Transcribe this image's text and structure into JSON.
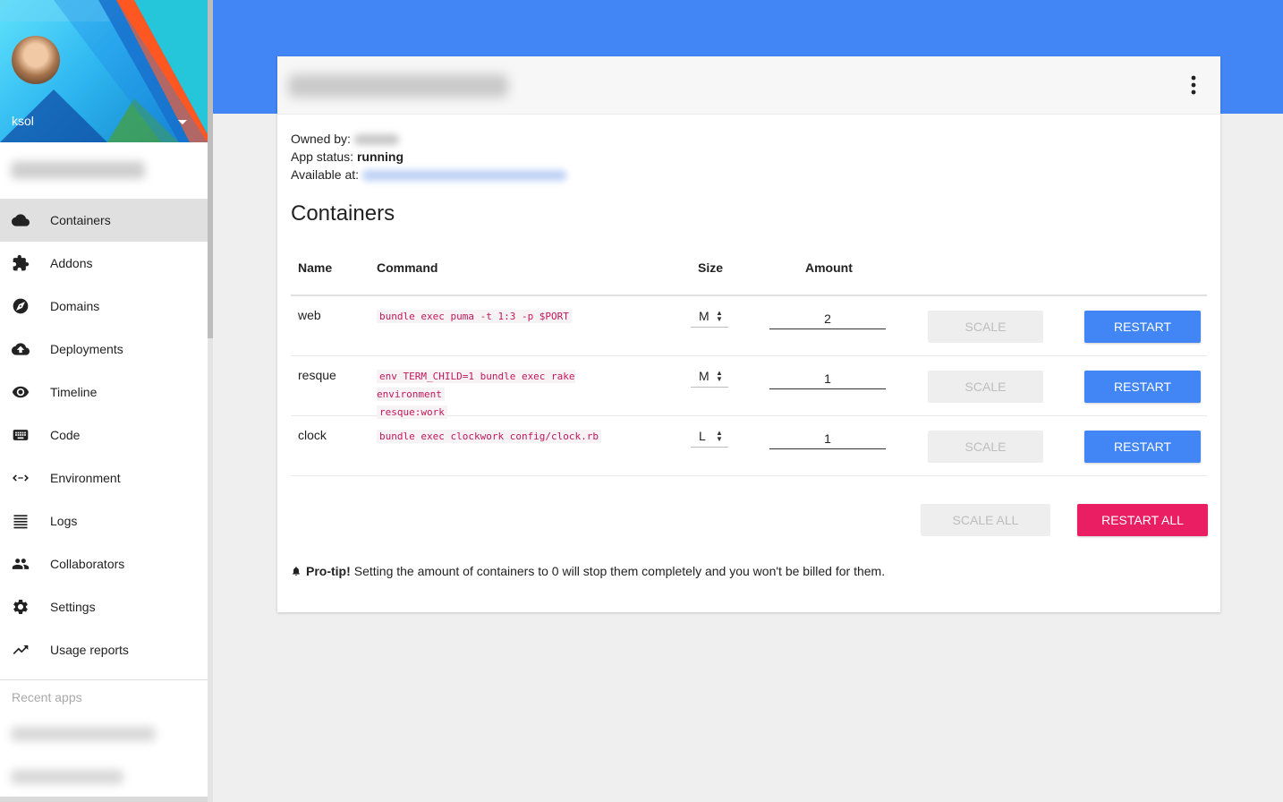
{
  "sidebar": {
    "username": "ksol",
    "nav": [
      {
        "label": "Containers",
        "icon": "cloud-icon",
        "active": true
      },
      {
        "label": "Addons",
        "icon": "puzzle-icon"
      },
      {
        "label": "Domains",
        "icon": "compass-icon"
      },
      {
        "label": "Deployments",
        "icon": "cloud-upload-icon"
      },
      {
        "label": "Timeline",
        "icon": "eye-icon"
      },
      {
        "label": "Code",
        "icon": "keyboard-icon"
      },
      {
        "label": "Environment",
        "icon": "code-arrows-icon"
      },
      {
        "label": "Logs",
        "icon": "list-icon"
      },
      {
        "label": "Collaborators",
        "icon": "people-icon"
      },
      {
        "label": "Settings",
        "icon": "gear-icon"
      },
      {
        "label": "Usage reports",
        "icon": "trending-up-icon"
      }
    ],
    "recent_label": "Recent apps"
  },
  "card": {
    "owned_by_label": "Owned by:",
    "status_label": "App status:",
    "status_value": "running",
    "available_label": "Available at:",
    "section_title": "Containers",
    "columns": {
      "name": "Name",
      "command": "Command",
      "size": "Size",
      "amount": "Amount"
    },
    "rows": [
      {
        "name": "web",
        "command_lines": [
          "bundle exec puma -t 1:3 -p $PORT"
        ],
        "size": "M",
        "amount": "2"
      },
      {
        "name": "resque",
        "command_lines": [
          "env TERM_CHILD=1 bundle exec rake environment",
          "resque:work"
        ],
        "size": "M",
        "amount": "1"
      },
      {
        "name": "clock",
        "command_lines": [
          "bundle exec clockwork config/clock.rb"
        ],
        "size": "L",
        "amount": "1"
      }
    ],
    "scale_label": "SCALE",
    "restart_label": "RESTART",
    "scale_all_label": "SCALE ALL",
    "restart_all_label": "RESTART ALL",
    "protip_bold": "Pro-tip!",
    "protip_text": "Setting the amount of containers to 0 will stop them completely and you won't be billed for them."
  },
  "colors": {
    "banner": "#4285f4",
    "restart": "#4285f4",
    "restart_all": "#e91e63",
    "command": "#c2185b"
  }
}
